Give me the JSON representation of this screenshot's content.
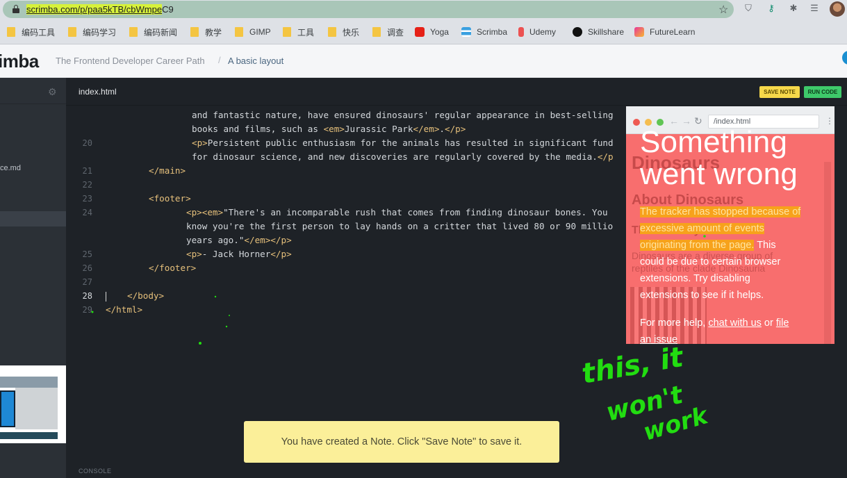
{
  "browser": {
    "url_highlighted": "scrimba.com/p/paa5kTB/cbWmpe",
    "url_rest": "C9",
    "bookmarks": [
      {
        "label": "编码工具",
        "type": "folder"
      },
      {
        "label": "编码学习",
        "type": "folder"
      },
      {
        "label": "编码新闻",
        "type": "folder"
      },
      {
        "label": "教学",
        "type": "folder"
      },
      {
        "label": "GIMP",
        "type": "folder"
      },
      {
        "label": "工具",
        "type": "folder"
      },
      {
        "label": "快乐",
        "type": "folder"
      },
      {
        "label": "调查",
        "type": "folder"
      },
      {
        "label": "Yoga",
        "type": "youtube"
      },
      {
        "label": "Scrimba",
        "type": "scrimba"
      },
      {
        "label": "Udemy",
        "type": "udemy"
      },
      {
        "label": "Skillshare",
        "type": "skillshare"
      },
      {
        "label": "FutureLearn",
        "type": "futurelearn"
      }
    ]
  },
  "header": {
    "logo": "imba",
    "course": "The Frontend Developer Career Path",
    "separator": "/",
    "lesson": "A basic layout"
  },
  "sidebar": {
    "file_partial": "ce.md"
  },
  "editor": {
    "tab": "index.html",
    "save_note": "SAVE NOTE",
    "run_code": "RUN CODE",
    "console": "CONSOLE",
    "line_numbers": [
      "20",
      "21",
      "22",
      "23",
      "24",
      "25",
      "26",
      "27",
      "28",
      "29"
    ],
    "lines": {
      "a": "and fantastic nature, have ensured dinosaurs' regular appearance in best-selling",
      "b_pre": "books and films, such as ",
      "b_em_open": "<em>",
      "b_mid": "Jurassic Park",
      "b_em_close": "</em>",
      "b_dot": ".",
      "b_p_close": "</p>",
      "c_p": "<p>",
      "c_text": "Persistent public enthusiasm for the animals has resulted in significant fund",
      "d_text": "for dinosaur science, and new discoveries are regularly covered by the media.",
      "d_p_close": "</p",
      "main_close": "</main>",
      "footer_open": "<footer>",
      "e_tags": "<p><em>",
      "e_text": "\"There's an incomparable rush that comes from finding dinosaur bones. You",
      "f_text": "know you're the first person to lay hands on a critter that lived 80 or 90 millio",
      "g_text": "years ago.\"",
      "g_tags": "</em></p>",
      "h_p": "<p>",
      "h_text": "- Jack Horner",
      "h_p_close": "</p>",
      "footer_close": "</footer>",
      "body_close": "</body>",
      "html_close": "</html>"
    }
  },
  "toast": "You have created a Note. Click \"Save Note\" to save it.",
  "preview": {
    "url": "/index.html",
    "background_heading_1": "Dinosaurs",
    "background_heading_2": "About Dinosaurs",
    "background_heading_3": "Their History",
    "background_text": "Dinosaurs are a diverse group of reptiles of the clade Dinosauria",
    "error_title_1": "Something",
    "error_title_2": "went wrong",
    "error_msg_orange_1": "The tracker has stopped because of",
    "error_msg_orange_2": "excessive amount of events",
    "error_msg_orange_3": "originating from the page.",
    "error_msg_rest_1": " This",
    "error_msg_rest_2": "could be due to certain browser",
    "error_msg_rest_3": "extensions. Try disabling",
    "error_msg_rest_4": "extensions to see if it helps.",
    "help_prefix": "For more help, ",
    "help_link_1": "chat with us",
    "help_or": " or ",
    "help_link_2": "file",
    "help_link_2b": "an issue"
  },
  "annotation": {
    "line1": "this, it",
    "line2": "won't",
    "line3": "work",
    "color": "#22dd11"
  }
}
